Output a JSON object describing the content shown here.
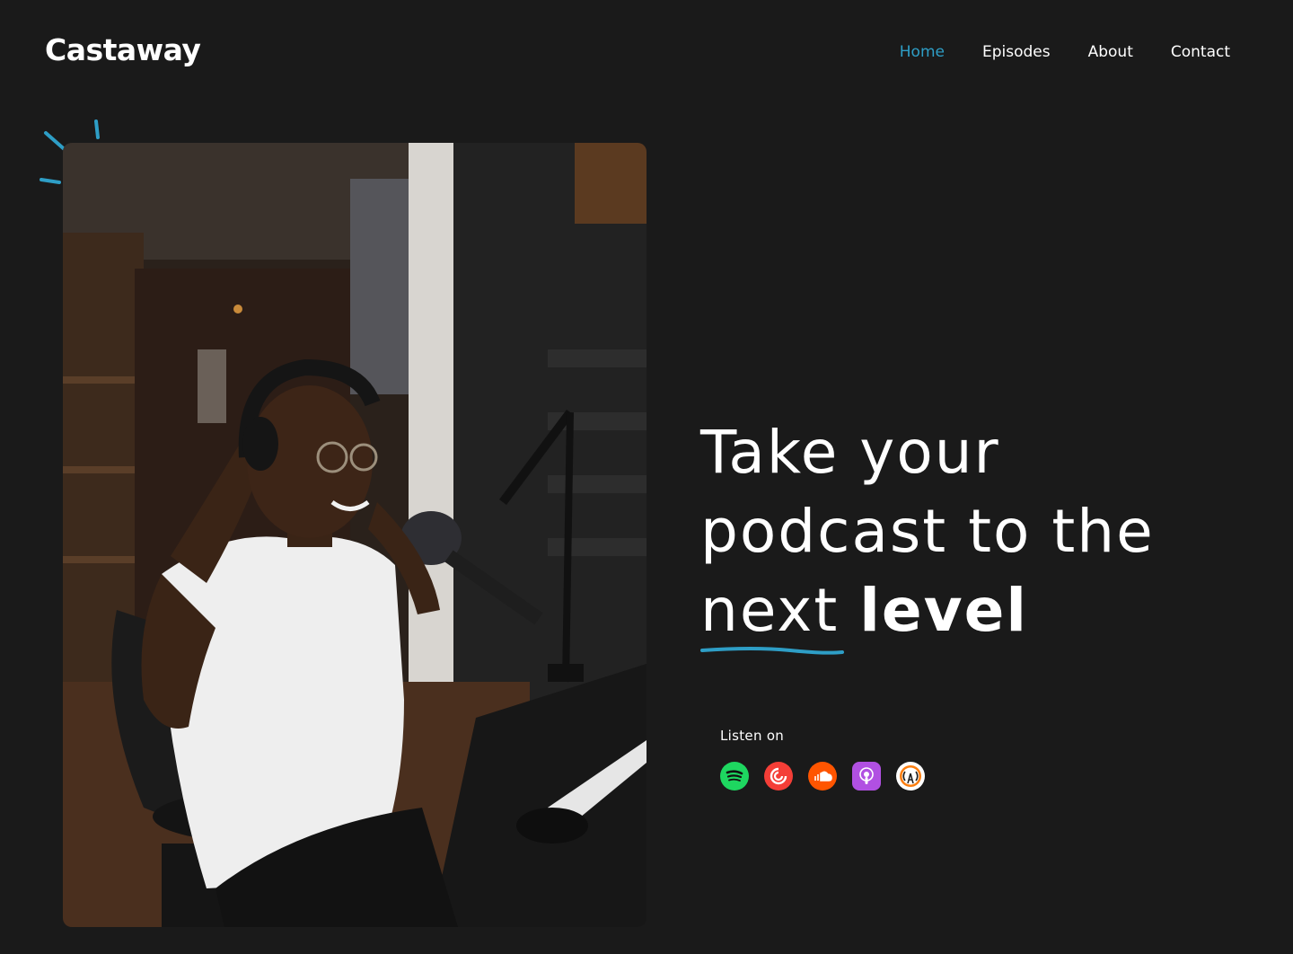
{
  "brand": {
    "name": "Castaway"
  },
  "nav": {
    "items": [
      {
        "label": "Home",
        "active": true
      },
      {
        "label": "Episodes",
        "active": false
      },
      {
        "label": "About",
        "active": false
      },
      {
        "label": "Contact",
        "active": false
      }
    ]
  },
  "hero": {
    "headline": {
      "line1": "Take your",
      "line2": "podcast to the",
      "line3_underlined": "next",
      "line3_bold": "level"
    },
    "listen_label": "Listen on",
    "platforms": [
      {
        "name": "spotify-icon",
        "color": "#1ed760"
      },
      {
        "name": "pocket-casts-icon",
        "color": "#f43e37"
      },
      {
        "name": "soundcloud-icon",
        "color": "#ff5500"
      },
      {
        "name": "apple-podcasts-icon",
        "color": "#b150e2"
      },
      {
        "name": "overcast-icon",
        "color": "#fc7e0f"
      }
    ]
  },
  "colors": {
    "accent": "#2e9ec6",
    "background": "#1a1a1a",
    "text": "#ffffff"
  }
}
